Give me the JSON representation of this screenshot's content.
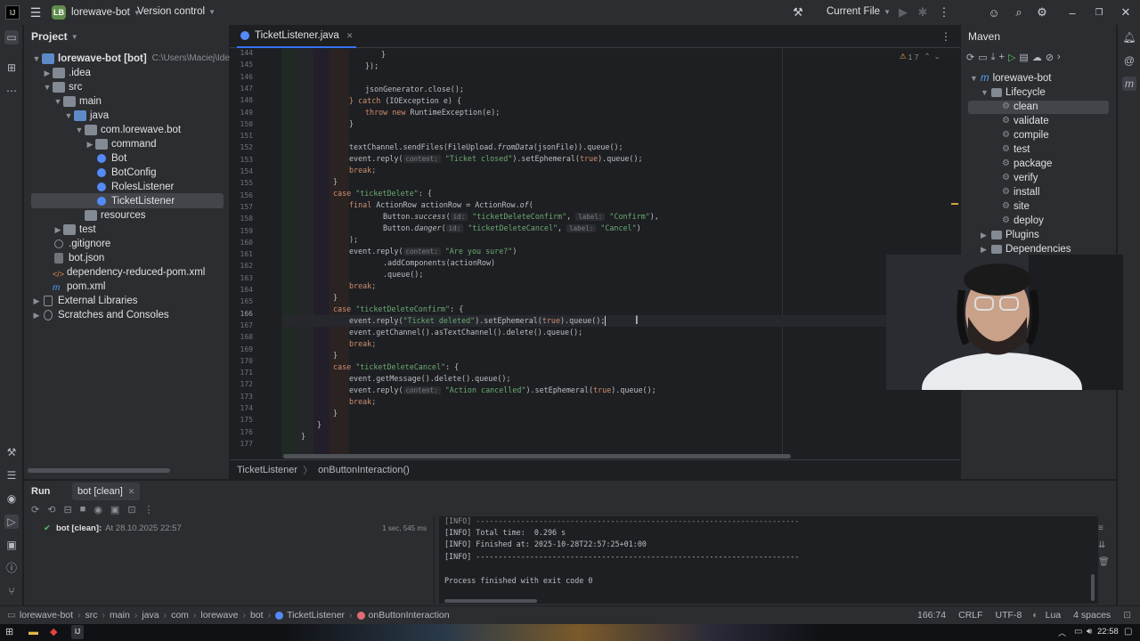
{
  "titlebar": {
    "project_badge": "LB",
    "project_name": "lorewave-bot",
    "vcs": "Version control",
    "run_config": "Current File",
    "icons": [
      "app-logo-icon",
      "hamburger-icon",
      "hammer-icon",
      "run-icon",
      "debug-icon",
      "more-icon",
      "account-icon",
      "search-icon",
      "settings-icon",
      "minimize-icon",
      "maximize-icon",
      "close-icon"
    ]
  },
  "project": {
    "header": "Project",
    "tree": [
      {
        "label": "lorewave-bot [bot]",
        "detail": "C:\\Users\\Maciej\\IdeaPro"
      },
      {
        "label": ".idea"
      },
      {
        "label": "src"
      },
      {
        "label": "main"
      },
      {
        "label": "java"
      },
      {
        "label": "com.lorewave.bot"
      },
      {
        "label": "command"
      },
      {
        "label": "Bot"
      },
      {
        "label": "BotConfig"
      },
      {
        "label": "RolesListener"
      },
      {
        "label": "TicketListener"
      },
      {
        "label": "resources"
      },
      {
        "label": "test"
      },
      {
        "label": ".gitignore"
      },
      {
        "label": "bot.json"
      },
      {
        "label": "dependency-reduced-pom.xml"
      },
      {
        "label": "pom.xml"
      },
      {
        "label": "External Libraries"
      },
      {
        "label": "Scratches and Consoles"
      }
    ]
  },
  "editor": {
    "tab": "TicketListener.java",
    "inspections": "1  7",
    "line_numbers": [
      "144",
      "145",
      "146",
      "147",
      "148",
      "149",
      "150",
      "151",
      "152",
      "153",
      "154",
      "155",
      "156",
      "157",
      "158",
      "159",
      "160",
      "161",
      "162",
      "163",
      "164",
      "165",
      "166",
      "167",
      "168",
      "169",
      "170",
      "171",
      "172",
      "173",
      "174",
      "175",
      "176",
      "177"
    ],
    "breadcrumb": [
      "TicketListener",
      "onButtonInteraction()"
    ]
  },
  "code": {
    "l0": "}",
    "l1": "});",
    "l3": "jsonGenerator.close();",
    "l4_kw": "} catch",
    "l4": " (IOException e) {",
    "l5_kw": "throw new",
    "l5": " RuntimeException(e);",
    "l6": "}",
    "l8a": "textChannel.sendFiles(FileUpload.",
    "l8b": "fromData",
    "l8c": "(jsonFile)).queue();",
    "l9a": "event.reply(",
    "l9h": "content:",
    "l9s": "\"Ticket closed\"",
    "l9b": ").setEphemeral(",
    "l9k": "true",
    "l9c": ").queue();",
    "l10": "break;",
    "l11": "}",
    "l12a": "case",
    "l12s": "\"ticketDelete\"",
    "l12b": ": {",
    "l13a": "final",
    "l13b": " ActionRow actionRow = ActionRow.",
    "l13c": "of",
    "l13d": "(",
    "l14a": "Button.",
    "l14b": "success",
    "l14c": "(",
    "l14h1": "id:",
    "l14s1": "\"ticketDeleteConfirm\"",
    "l14h2": "label:",
    "l14s2": "\"Confirm\"",
    "l14d": "),",
    "l15a": "Button.",
    "l15b": "danger",
    "l15c": "(",
    "l15h1": "id:",
    "l15s1": "\"ticketDeleteCancel\"",
    "l15h2": "label:",
    "l15s2": "\"Cancel\"",
    "l15d": ")",
    "l16": ");",
    "l17a": "event.reply(",
    "l17h": "content:",
    "l17s": "\"Are you sure?\"",
    "l17b": ")",
    "l18": ".addComponents(actionRow)",
    "l19": ".queue();",
    "l20": "break;",
    "l21": "}",
    "l22a": "case",
    "l22s": "\"ticketDeleteConfirm\"",
    "l22b": ": {",
    "l23a": "event.reply(",
    "l23s": "\"Ticket deleted\"",
    "l23b": ").setEphemeral(",
    "l23k": "true",
    "l23c": ").queue();",
    "l24": "event.getChannel().asTextChannel().delete().queue();",
    "l25": "break;",
    "l26": "}",
    "l27a": "case",
    "l27s": "\"ticketDeleteCancel\"",
    "l27b": ": {",
    "l28": "event.getMessage().delete().queue();",
    "l29a": "event.reply(",
    "l29h": "content:",
    "l29s": "\"Action cancelled\"",
    "l29b": ").setEphemeral(",
    "l29k": "true",
    "l29c": ").queue();",
    "l30": "break;",
    "l31": "}",
    "l32": "}",
    "l33": "}"
  },
  "maven": {
    "header": "Maven",
    "project": "lorewave-bot",
    "lifecycle": "Lifecycle",
    "goals": [
      "clean",
      "validate",
      "compile",
      "test",
      "package",
      "verify",
      "install",
      "site",
      "deploy"
    ],
    "plugins": "Plugins",
    "dependencies": "Dependencies"
  },
  "run": {
    "tab_run": "Run",
    "tab_config": "bot [clean]",
    "item_label": "bot [clean]:",
    "item_time": "At 28.10.2025 22:57",
    "item_duration": "1 sec, 545 ms",
    "console": [
      "[INFO] ------------------------------------------------------------------------",
      "[INFO] Total time:  0.296 s",
      "[INFO] Finished at: 2025-10-28T22:57:25+01:00",
      "[INFO] ------------------------------------------------------------------------",
      "",
      "Process finished with exit code 0"
    ]
  },
  "statusbar": {
    "path": [
      "lorewave-bot",
      "src",
      "main",
      "java",
      "com",
      "lorewave",
      "bot",
      "TicketListener",
      "onButtonInteraction"
    ],
    "position": "166:74",
    "line_sep": "CRLF",
    "encoding": "UTF-8",
    "language": "Lua",
    "indent": "4 spaces"
  },
  "taskbar": {
    "clock": "22:58"
  },
  "colors": {
    "accent": "#3574f0",
    "background": "#1e1f22",
    "panel": "#2b2d30",
    "keyword": "#cf8e6d",
    "string": "#6aab73"
  }
}
